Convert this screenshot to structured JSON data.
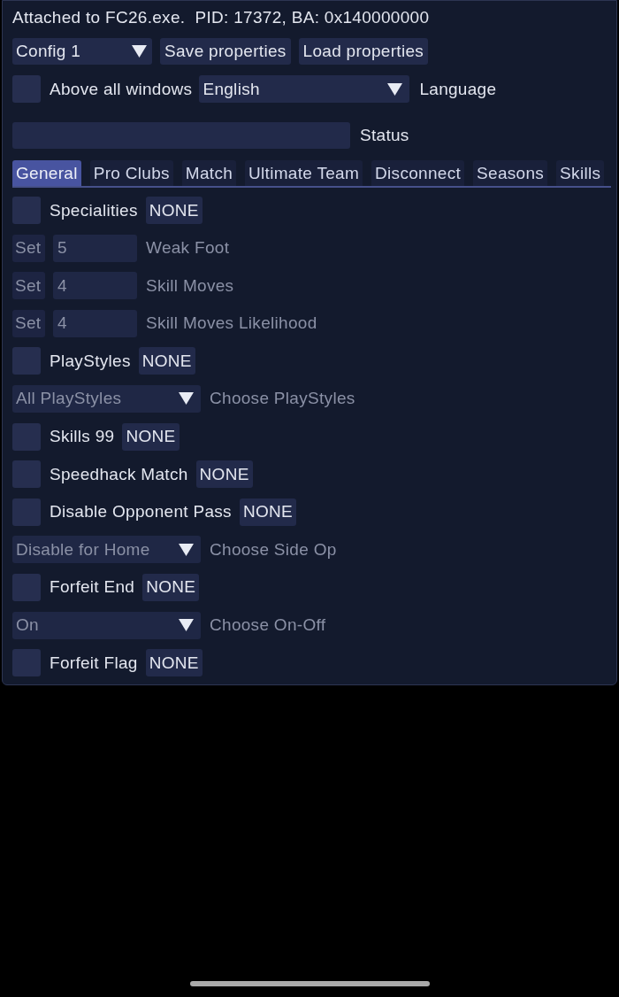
{
  "window": {
    "title": "Attached to FC26.exe.  PID: 17372, BA: 0x140000000"
  },
  "toolbar": {
    "config": {
      "value": "Config 1"
    },
    "buttons": [
      "Save properties",
      "Load properties"
    ]
  },
  "options": {
    "above_all_windows": {
      "label": "Above all windows",
      "checked": false
    },
    "language": {
      "value": "English",
      "label": "Language"
    }
  },
  "status": {
    "label": "Status"
  },
  "tabs": [
    {
      "label": "General",
      "selected": true
    },
    {
      "label": "Pro Clubs",
      "selected": false
    },
    {
      "label": "Match",
      "selected": false
    },
    {
      "label": "Ultimate Team",
      "selected": false
    },
    {
      "label": "Disconnect",
      "selected": false
    },
    {
      "label": "Seasons",
      "selected": false
    },
    {
      "label": "Skills",
      "selected": false
    }
  ],
  "rows": [
    {
      "kind": "toggle",
      "label": "Specialities",
      "checked": false,
      "hotkey": "NONE",
      "disabled": false
    },
    {
      "kind": "set",
      "button": "Set",
      "input": {
        "value": "5"
      },
      "label": "Weak Foot",
      "disabled": true
    },
    {
      "kind": "set",
      "button": "Set",
      "input": {
        "value": "4"
      },
      "label": "Skill Moves",
      "disabled": true
    },
    {
      "kind": "set",
      "button": "Set",
      "input": {
        "value": "4"
      },
      "label": "Skill Moves Likelihood",
      "disabled": true
    },
    {
      "kind": "toggle",
      "label": "PlayStyles",
      "checked": false,
      "hotkey": "NONE",
      "disabled": false
    },
    {
      "kind": "combo",
      "dropdown": {
        "value": "All PlayStyles"
      },
      "label": "Choose PlayStyles",
      "disabled": true
    },
    {
      "kind": "toggle",
      "label": "Skills 99",
      "checked": false,
      "hotkey": "NONE",
      "disabled": false
    },
    {
      "kind": "toggle",
      "label": "Speedhack Match",
      "checked": false,
      "hotkey": "NONE",
      "disabled": false
    },
    {
      "kind": "toggle",
      "label": "Disable Opponent Pass",
      "checked": false,
      "hotkey": "NONE",
      "disabled": false
    },
    {
      "kind": "combo",
      "dropdown": {
        "value": "Disable for Home"
      },
      "label": "Choose Side Op",
      "disabled": true
    },
    {
      "kind": "toggle",
      "label": "Forfeit End",
      "checked": false,
      "hotkey": "NONE",
      "disabled": false
    },
    {
      "kind": "combo",
      "dropdown": {
        "value": "On"
      },
      "label": "Choose On-Off",
      "disabled": true
    },
    {
      "kind": "toggle",
      "label": "Forfeit Flag",
      "checked": false,
      "hotkey": "NONE",
      "disabled": false
    }
  ]
}
